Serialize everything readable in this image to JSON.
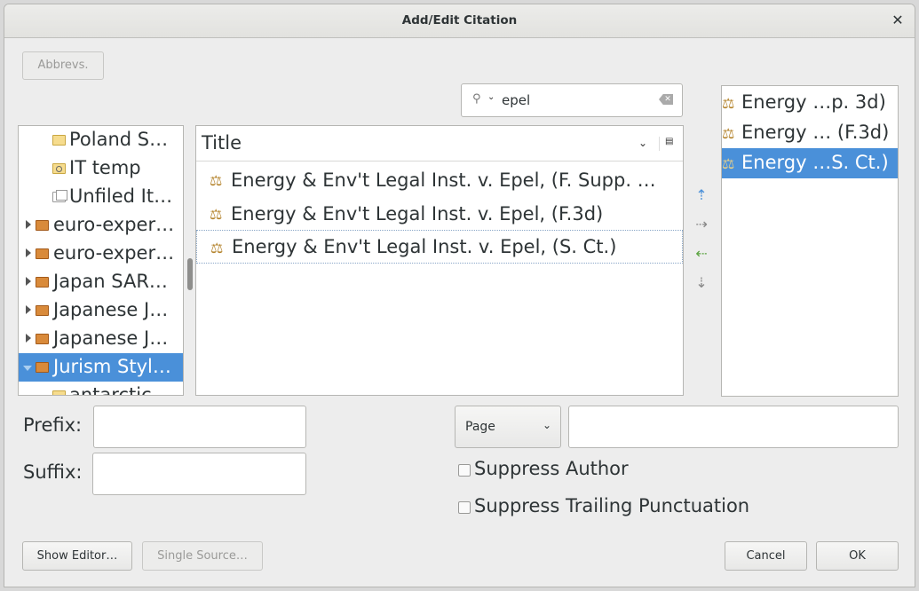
{
  "window": {
    "title": "Add/Edit Citation"
  },
  "toolbar": {
    "abbrevs_label": "Abbrevs."
  },
  "search": {
    "value": "epel",
    "dropdown_glyph": "⌄"
  },
  "tree": {
    "items": [
      {
        "label": "Poland S…",
        "icon": "folder-icon"
      },
      {
        "label": "IT temp",
        "icon": "saved-search-icon"
      },
      {
        "label": "Unfiled It…",
        "icon": "unfiled-icon"
      },
      {
        "label": "euro-exper…",
        "icon": "library-icon"
      },
      {
        "label": "euro-exper…",
        "icon": "library-icon"
      },
      {
        "label": "Japan SAR…",
        "icon": "library-icon"
      },
      {
        "label": "Japanese J…",
        "icon": "library-icon"
      },
      {
        "label": "Japanese J…",
        "icon": "library-icon"
      },
      {
        "label": "Jurism Styl…",
        "icon": "library-icon",
        "selected": true
      },
      {
        "label": "antarctic…",
        "icon": "folder-icon"
      }
    ]
  },
  "items": {
    "column_title": "Title",
    "rows": [
      {
        "label": "Energy & Env't Legal Inst. v. Epel, (F. Supp. …"
      },
      {
        "label": "Energy & Env't Legal Inst. v. Epel, (F.3d)"
      },
      {
        "label": "Energy & Env't Legal Inst. v. Epel, (S. Ct.)"
      }
    ]
  },
  "mover": {
    "up": "⇡",
    "right": "⇢",
    "left": "⇠",
    "down": "⇣"
  },
  "selected_items": [
    {
      "label": "Energy …p. 3d)"
    },
    {
      "label": "Energy … (F.3d)"
    },
    {
      "label": "Energy …S. Ct.)",
      "selected": true
    }
  ],
  "fields": {
    "prefix_label": "Prefix:",
    "suffix_label": "Suffix:",
    "locator_type": "Page",
    "suppress_author_label": "Suppress Author",
    "suppress_trailing_label": "Suppress Trailing Punctuation"
  },
  "buttons": {
    "show_editor": "Show Editor…",
    "single_source": "Single Source…",
    "cancel": "Cancel",
    "ok": "OK"
  },
  "colors": {
    "selection": "#4a90d9",
    "accent_icon": "#b3822a"
  }
}
